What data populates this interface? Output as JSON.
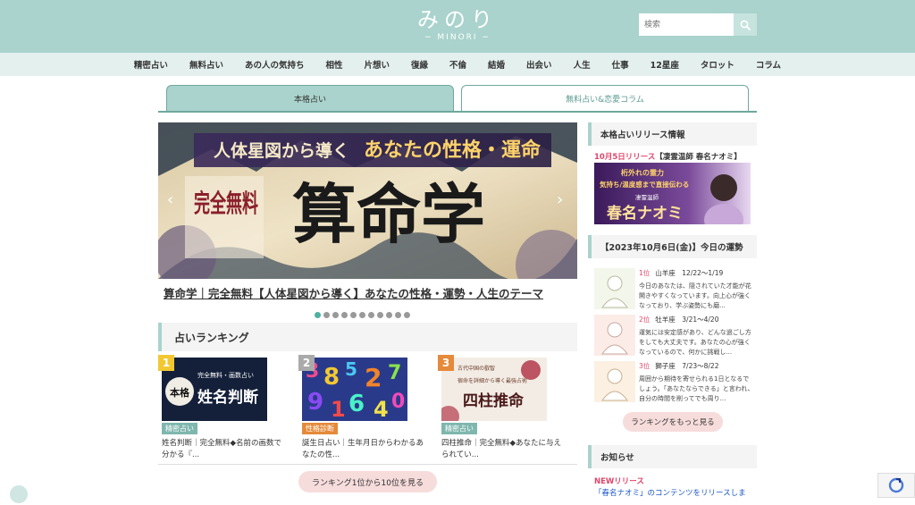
{
  "header": {
    "logo_main": "みのり",
    "logo_sub": "− MINORI −",
    "search_placeholder": "検索"
  },
  "nav": [
    "精密占い",
    "無料占い",
    "あの人の気持ち",
    "相性",
    "片想い",
    "復縁",
    "不倫",
    "結婚",
    "出会い",
    "人生",
    "仕事",
    "12星座",
    "タロット",
    "コラム"
  ],
  "tabs": [
    {
      "label": "本格占い"
    },
    {
      "label": "無料占い&恋愛コラム"
    }
  ],
  "slider": {
    "banner_line1": "人体星図から導く",
    "banner_line2": "あなたの性格・運命",
    "banner_badge": "完全無料",
    "banner_title": "算命学",
    "caption": "算命学｜完全無料【人体星図から導く】あなたの性格・運勢・人生のテーマ",
    "prev": "‹",
    "next": "›"
  },
  "ranking": {
    "title": "占いランキング",
    "items": [
      {
        "rank": "1",
        "tag": "精密占い",
        "img_sub": "完全無料・画数占い",
        "img_main": "姓名判断",
        "img_kanji": "本格",
        "desc": "姓名判断｜完全無料◆名前の画数で分かる『..."
      },
      {
        "rank": "2",
        "tag": "性格診断",
        "img_main": "",
        "desc": "誕生日占い｜生年月日からわかるあなたの性..."
      },
      {
        "rank": "3",
        "tag": "精密占い",
        "img_sub": "宿命を詳細から導く最強占術",
        "img_main": "四柱推命",
        "img_top": "古代中国の叡智",
        "desc": "四柱推命｜完全無料◆あなたに与えられてい..."
      }
    ],
    "more": "ランキング1位から10位を見る"
  },
  "sidebar": {
    "release_title": "本格占いリリース情報",
    "release_date": "10月5日リリース",
    "release_name": "【凄霊温師 春名ナオミ】",
    "release_banner_line1": "桁外れの霊力",
    "release_banner_line2": "気持ち/温度感まで直接伝わる",
    "release_banner_tag": "凄霊温師",
    "release_banner_name": "春名ナオミ",
    "fortune_title": "【2023年10月6日(金)】今日の運勢",
    "fortunes": [
      {
        "rank": "1位",
        "sign": "山羊座　12/22～1/19",
        "text": "今日のあなたは、隠されていた才能が花開きやすくなっています。向上心が強くなっており、学ぶ姿勢にも磨..."
      },
      {
        "rank": "2位",
        "sign": "牡羊座　3/21～4/20",
        "text": "運気には安定感があり、どんな過ごし方をしても大丈夫です。あなたの心が強くなっているので、何かに挑戦し..."
      },
      {
        "rank": "3位",
        "sign": "獅子座　7/23～8/22",
        "text": "周囲から期待を寄せられる1日となるでしょう。「あなたならできる」と言われ、自分の時間を削ってでも周り..."
      }
    ],
    "fortune_more": "ランキングをもっと見る",
    "news_title": "お知らせ",
    "news_new": "NEWリリース",
    "news_text": "「春名ナオミ」のコンテンツをリリースしま"
  },
  "colors": {
    "accent": "#a9d3cc",
    "accent_dark": "#6fa89e",
    "pink": "#e0456a",
    "pink_bg": "#f7dcdc"
  }
}
